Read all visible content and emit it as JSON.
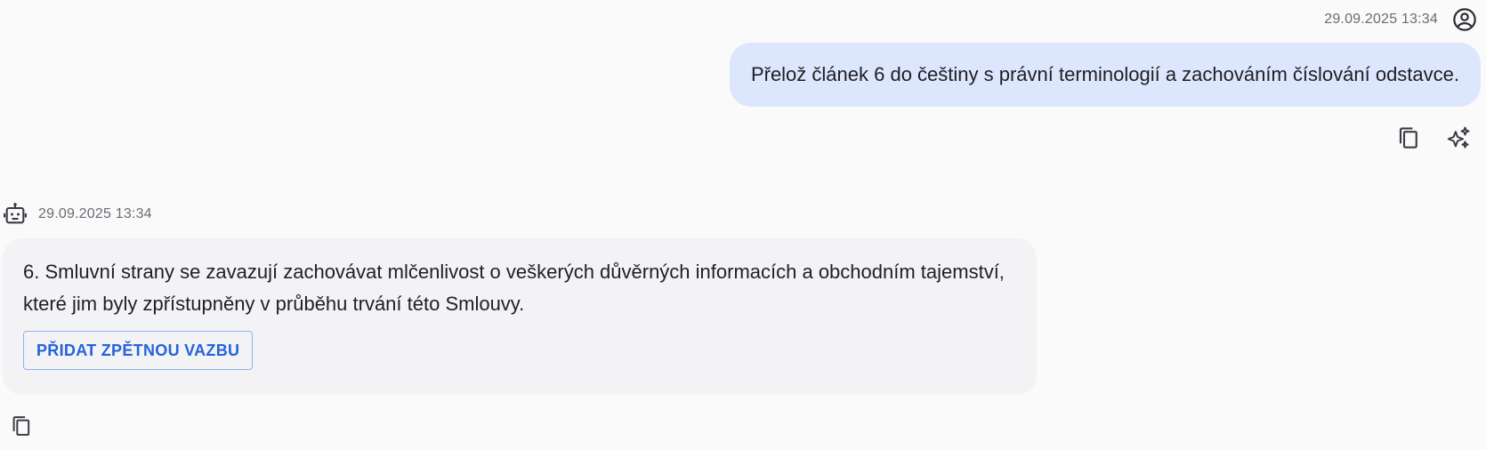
{
  "user_message": {
    "timestamp": "29.09.2025 13:34",
    "avatar_icon": "account-circle-icon",
    "text": "Přelož článek 6 do češtiny s právní terminologií a zachováním číslování odstavce.",
    "bubble_color": "#dce6fd",
    "actions": [
      {
        "icon": "copy-icon"
      },
      {
        "icon": "sparkle-icon"
      }
    ]
  },
  "bot_message": {
    "timestamp": "29.09.2025 13:34",
    "avatar_icon": "robot-icon",
    "text": "6. Smluvní strany se zavazují zachovávat mlčenlivost o veškerých důvěrných informacích a obchodním tajemství, které jim byly zpřístupněny v průběhu trvání této Smlouvy.",
    "feedback_button_label": "PŘIDAT ZPĚTNOU VAZBU",
    "bubble_color": "#f3f3f6",
    "accent_color": "#2563d9",
    "actions": [
      {
        "icon": "copy-icon"
      }
    ]
  }
}
